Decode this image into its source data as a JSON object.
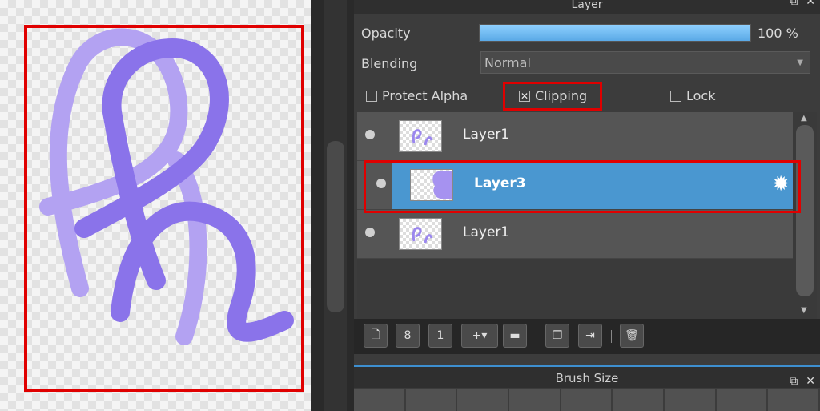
{
  "layer_panel": {
    "title": "Layer",
    "opacity_label": "Opacity",
    "opacity_value": "100 %",
    "opacity_fraction": 1.0,
    "blending_label": "Blending",
    "blending_value": "Normal",
    "protect_alpha_label": "Protect Alpha",
    "clipping_label": "Clipping",
    "lock_label": "Lock",
    "clipping_checked": true
  },
  "layers": [
    {
      "name": "Layer1",
      "selected": false
    },
    {
      "name": "Layer3",
      "selected": true
    },
    {
      "name": "Layer1",
      "selected": false
    }
  ],
  "toolbar": {
    "icons": [
      "new-layer-icon",
      "new-8bit-layer-icon",
      "new-1bit-layer-icon",
      "add-layer-menu-icon",
      "new-folder-icon",
      "duplicate-layer-icon",
      "merge-layer-icon",
      "delete-layer-icon"
    ]
  },
  "brush_panel": {
    "title": "Brush Size"
  },
  "colors": {
    "accent": "#4a97d0",
    "highlight_red": "#e00000",
    "stroke_light": "#b3a2f2",
    "stroke_dark": "#8a73ea"
  }
}
